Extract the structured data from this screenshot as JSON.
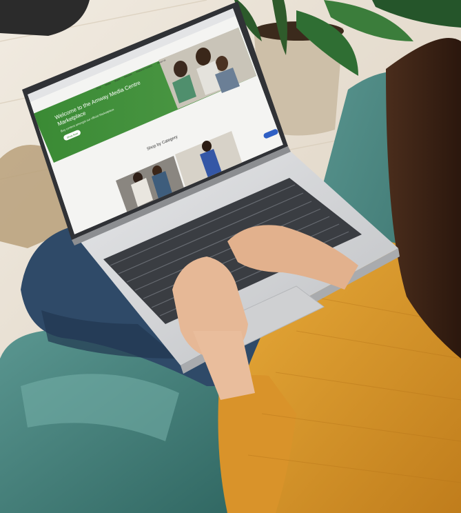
{
  "screen": {
    "hero_headline_line1": "Welcome to the Amway Media Centre",
    "hero_headline_line2": "Marketplace",
    "hero_subline": "Buy content amongst our official Marketplace",
    "hero_button_label": "Shop Now",
    "section_heading": "Shop by Category",
    "nav_items": [
      "Shop",
      "Media",
      "Brand",
      "Discover",
      "Featured Content",
      "About Us"
    ]
  },
  "colors": {
    "hero_green": "#3f8a3a",
    "sweater_mustard": "#dc9a2a",
    "sofa_teal": "#4a8580",
    "laptop_silver": "#d9dadc",
    "jeans_blue": "#2f4a68",
    "wall_cream": "#ece4d8"
  }
}
